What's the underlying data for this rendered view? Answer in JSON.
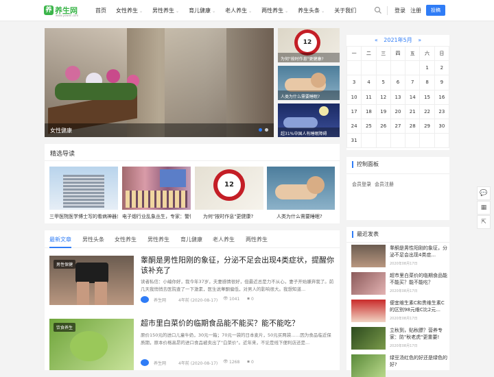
{
  "header": {
    "logo_mark": "养",
    "logo_text": "养生网",
    "logo_sub": "www.yswen.com",
    "nav": [
      {
        "label": "首页",
        "dd": false
      },
      {
        "label": "女性养生",
        "dd": true
      },
      {
        "label": "男性养生",
        "dd": true
      },
      {
        "label": "育儿健康",
        "dd": true
      },
      {
        "label": "老人养生",
        "dd": true
      },
      {
        "label": "两性养生",
        "dd": true
      },
      {
        "label": "养生头条",
        "dd": true
      },
      {
        "label": "关于我们",
        "dd": false
      }
    ],
    "login": "登录",
    "register": "注册",
    "post": "投稿",
    "chevron": "⌄"
  },
  "slider": {
    "main_caption": "女性健康",
    "side": [
      "为何\"按时作息\"更健康?",
      "人类为什么需要睡眠?",
      "超31%中国人有睡眠障碍"
    ]
  },
  "featured": {
    "title": "精选导读",
    "items": [
      "三甲医院医学博士写的看病神器来了",
      "电子烟行业乱象丛生，专家：警惕",
      "为何\"按时作息\"更健康?",
      "人类为什么需要睡眠?"
    ]
  },
  "tabs": [
    "最新文章",
    "男性头条",
    "女性养生",
    "男性养生",
    "育儿健康",
    "老人养生",
    "两性养生"
  ],
  "articles": [
    {
      "badge": "男性保健",
      "title": "睾酮是男性阳刚的象征，分泌不足会出现4类症状，提醒你该补充了",
      "excerpt": "读者私信：小编你好，我今年37岁，夫妻感情很好，但最近总是力不从心，妻子开始嫌弃我了。前几天我悄悄去医院查了一下激素，医生说睾酮偏低，对男人的影响很大。我想知道...",
      "author": "养生网",
      "time": "4年前 (2020-08-17)",
      "views": "1041",
      "comments": "0"
    },
    {
      "badge": "饮食养生",
      "title": "超市里白菜价的临期食品能不能买？能不能吃？",
      "excerpt": "原价150元的进口儿童牛奶，30元一箱；70元一袋的日本麦片，50元买两袋……因为食品临近保质期，原本价格高昂的进口食品被卖出了\"白菜价\"。近年来，不论是线下便利店还是...",
      "author": "养生网",
      "time": "4年前 (2020-08-17)",
      "views": "1268",
      "comments": "0"
    }
  ],
  "calendar": {
    "prev": "«",
    "month": "2021年5月",
    "next": "»",
    "weekdays": [
      "一",
      "二",
      "三",
      "四",
      "五",
      "六",
      "日"
    ],
    "rows": [
      [
        "",
        "",
        "",
        "",
        "",
        "1",
        "2"
      ],
      [
        "3",
        "4",
        "5",
        "6",
        "7",
        "8",
        "9"
      ],
      [
        "10",
        "11",
        "12",
        "13",
        "14",
        "15",
        "16"
      ],
      [
        "17",
        "18",
        "19",
        "20",
        "21",
        "22",
        "23"
      ],
      [
        "24",
        "25",
        "26",
        "27",
        "28",
        "29",
        "30"
      ],
      [
        "31",
        "",
        "",
        "",
        "",
        "",
        ""
      ]
    ]
  },
  "control": {
    "title": "控制面板",
    "login": "会员登录",
    "register": "会员注册"
  },
  "recent": {
    "title": "最近发表",
    "items": [
      {
        "title": "睾酮是男性阳刚的象征，分泌不足会出现4类症...",
        "date": "2020年08月17日"
      },
      {
        "title": "超市里白菜价的临期食品能不能买？能不能吃？",
        "date": "2020年08月17日"
      },
      {
        "title": "便宜维生素C和贵维生素C的区别98元维C比2元...",
        "date": "2020年08月17日"
      },
      {
        "title": "立秋到，贴秋膘？营养专家：防\"秋老虎\"更重要!",
        "date": "2020年08月17日"
      },
      {
        "title": "绿豆汤红色的好还是绿色的好?",
        "date": ""
      }
    ]
  },
  "side_tools": [
    "💬",
    "▦",
    "⇱"
  ]
}
